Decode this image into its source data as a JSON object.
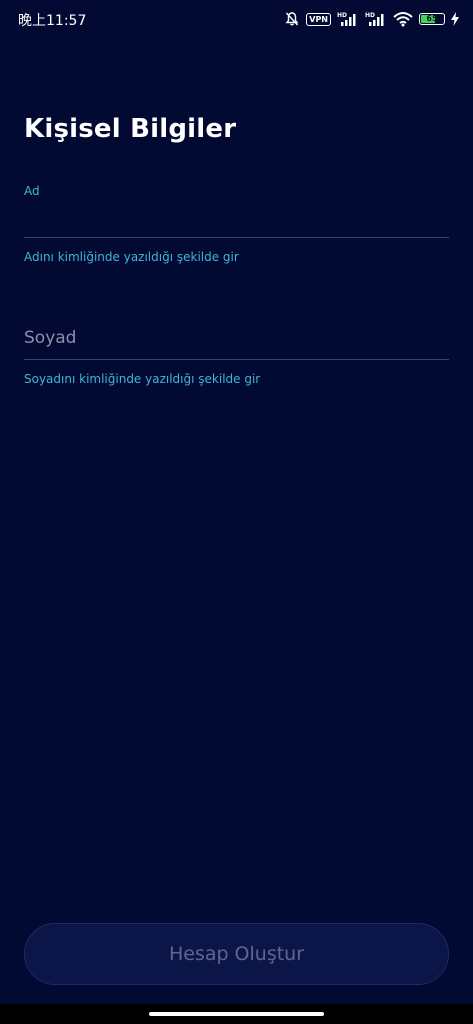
{
  "status_bar": {
    "time": "晚上11:57",
    "vpn_label": "VPN",
    "battery_level": "65",
    "battery_fraction": 0.65,
    "icons": [
      "bell-muted-icon",
      "vpn-icon",
      "signal-hd-icon",
      "signal-hd-icon",
      "wifi-icon",
      "battery-icon",
      "charging-icon"
    ]
  },
  "page": {
    "title": "Kişisel Bilgiler"
  },
  "form": {
    "first_name": {
      "label": "Ad",
      "value": "",
      "helper": "Adını kimliğinde yazıldığı şekilde gir"
    },
    "last_name": {
      "placeholder": "Soyad",
      "value": "",
      "helper": "Soyadını kimliğinde yazıldığı şekilde gir"
    }
  },
  "actions": {
    "submit_label": "Hesap Oluştur"
  },
  "colors": {
    "background": "#020a33",
    "accent": "#3fb6cf",
    "button_bg": "#0b1547",
    "button_text_disabled": "#5e6790"
  }
}
